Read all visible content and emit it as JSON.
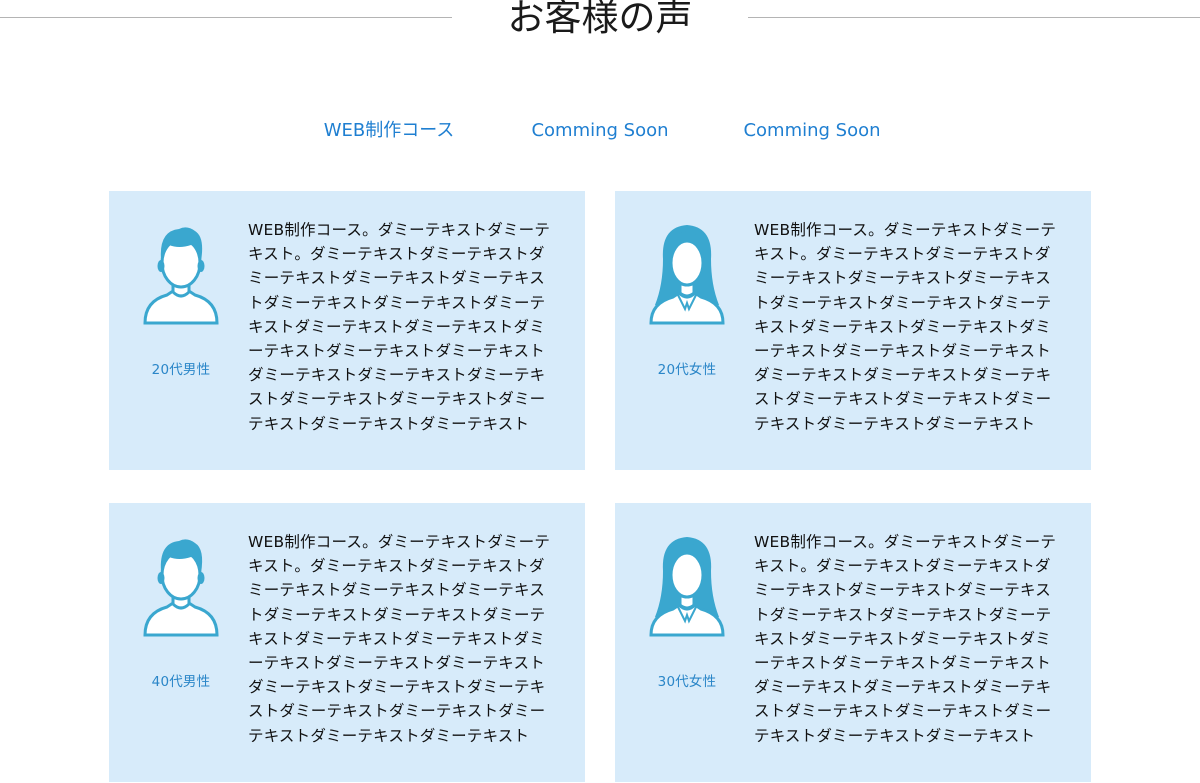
{
  "section": {
    "title": "お客様の声"
  },
  "tabs": [
    {
      "label": "WEB制作コース",
      "active": true
    },
    {
      "label": "Comming Soon",
      "active": false
    },
    {
      "label": "Comming Soon",
      "active": false
    }
  ],
  "colors": {
    "accent_text": "#1f7fd1",
    "tab_highlight": "#f5c07a",
    "card_bg": "#d7ebfa",
    "avatar": "#3aa7cf"
  },
  "testimonials": [
    {
      "avatar_icon": "male-user-icon",
      "age_label": "20代男性",
      "text": "WEB制作コース。ダミーテキストダミーテキスト。ダミーテキストダミーテキストダミーテキストダミーテキストダミーテキストダミーテキストダミーテキストダミーテキストダミーテキストダミーテキストダミーテキストダミーテキストダミーテキストダミーテキストダミーテキストダミーテキストダミーテキストダミーテキストダミーテキストダミーテキストダミーテキスト"
    },
    {
      "avatar_icon": "female-user-icon",
      "age_label": "20代女性",
      "text": "WEB制作コース。ダミーテキストダミーテキスト。ダミーテキストダミーテキストダミーテキストダミーテキストダミーテキストダミーテキストダミーテキストダミーテキストダミーテキストダミーテキストダミーテキストダミーテキストダミーテキストダミーテキストダミーテキストダミーテキストダミーテキストダミーテキストダミーテキストダミーテキストダミーテキスト"
    },
    {
      "avatar_icon": "male-user-icon",
      "age_label": "40代男性",
      "text": "WEB制作コース。ダミーテキストダミーテキスト。ダミーテキストダミーテキストダミーテキストダミーテキストダミーテキストダミーテキストダミーテキストダミーテキストダミーテキストダミーテキストダミーテキストダミーテキストダミーテキストダミーテキストダミーテキストダミーテキストダミーテキストダミーテキストダミーテキストダミーテキストダミーテキスト"
    },
    {
      "avatar_icon": "female-user-icon",
      "age_label": "30代女性",
      "text": "WEB制作コース。ダミーテキストダミーテキスト。ダミーテキストダミーテキストダミーテキストダミーテキストダミーテキストダミーテキストダミーテキストダミーテキストダミーテキストダミーテキストダミーテキストダミーテキストダミーテキストダミーテキストダミーテキストダミーテキストダミーテキストダミーテキストダミーテキストダミーテキストダミーテキスト"
    }
  ]
}
